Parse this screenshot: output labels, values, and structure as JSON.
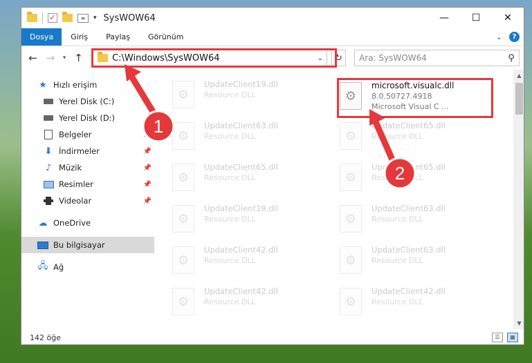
{
  "window": {
    "title": "SysWOW64",
    "minimize_glyph": "—",
    "maximize_glyph": "☐",
    "close_glyph": "✕"
  },
  "ribbon": {
    "tabs": [
      "Dosya",
      "Giriş",
      "Paylaş",
      "Görünüm"
    ]
  },
  "navigation": {
    "address": "C:\\Windows\\SysWOW64",
    "search_placeholder": "Ara: SysWOW64"
  },
  "sidebar": {
    "quick_access": "Hızlı erişim",
    "items": [
      {
        "label": "Yerel Disk (C:)",
        "icon": "drive-icon",
        "pinned": false
      },
      {
        "label": "Yerel Disk (D:)",
        "icon": "drive-icon",
        "pinned": false
      },
      {
        "label": "Belgeler",
        "icon": "documents-icon",
        "pinned": true
      },
      {
        "label": "İndirmeler",
        "icon": "download-icon",
        "pinned": true
      },
      {
        "label": "Müzik",
        "icon": "music-icon",
        "pinned": true
      },
      {
        "label": "Resimler",
        "icon": "pictures-icon",
        "pinned": true
      },
      {
        "label": "Videolar",
        "icon": "videos-icon",
        "pinned": true
      }
    ],
    "onedrive": "OneDrive",
    "this_pc": "Bu bilgisayar",
    "network": "Ağ"
  },
  "files": {
    "highlighted": {
      "name": "microsoft.visualc.dll",
      "version": "8.0.50727.4918",
      "description": "Microsoft Visual C ..."
    },
    "left_column": [
      {
        "name": "UpdateClient19.dll",
        "type": "Resource DLL"
      },
      {
        "name": "UpdateClient63.dll",
        "type": "Resource DLL"
      },
      {
        "name": "UpdateClient65.dll",
        "type": "Resource DLL"
      },
      {
        "name": "UpdateClient19.dll",
        "type": "Resource DLL"
      },
      {
        "name": "UpdateClient42.dll",
        "type": "Resource DLL"
      },
      {
        "name": "UpdateClient42.dll",
        "type": "Resource DLL"
      }
    ],
    "right_column": [
      {
        "name": "UpdateClient65.dll",
        "type": "Resource DLL"
      },
      {
        "name": "UpdateClient65.dll",
        "type": "Resource DLL"
      },
      {
        "name": "UpdateClient63.dll",
        "type": "Resource DLL"
      },
      {
        "name": "UpdateClient63.dll",
        "type": "Resource DLL"
      },
      {
        "name": "UpdateClient42.dll",
        "type": "Resource DLL"
      }
    ]
  },
  "status": {
    "count": "142 öğe"
  },
  "annotations": {
    "step1": "1",
    "step2": "2",
    "color": "#e5383b"
  }
}
